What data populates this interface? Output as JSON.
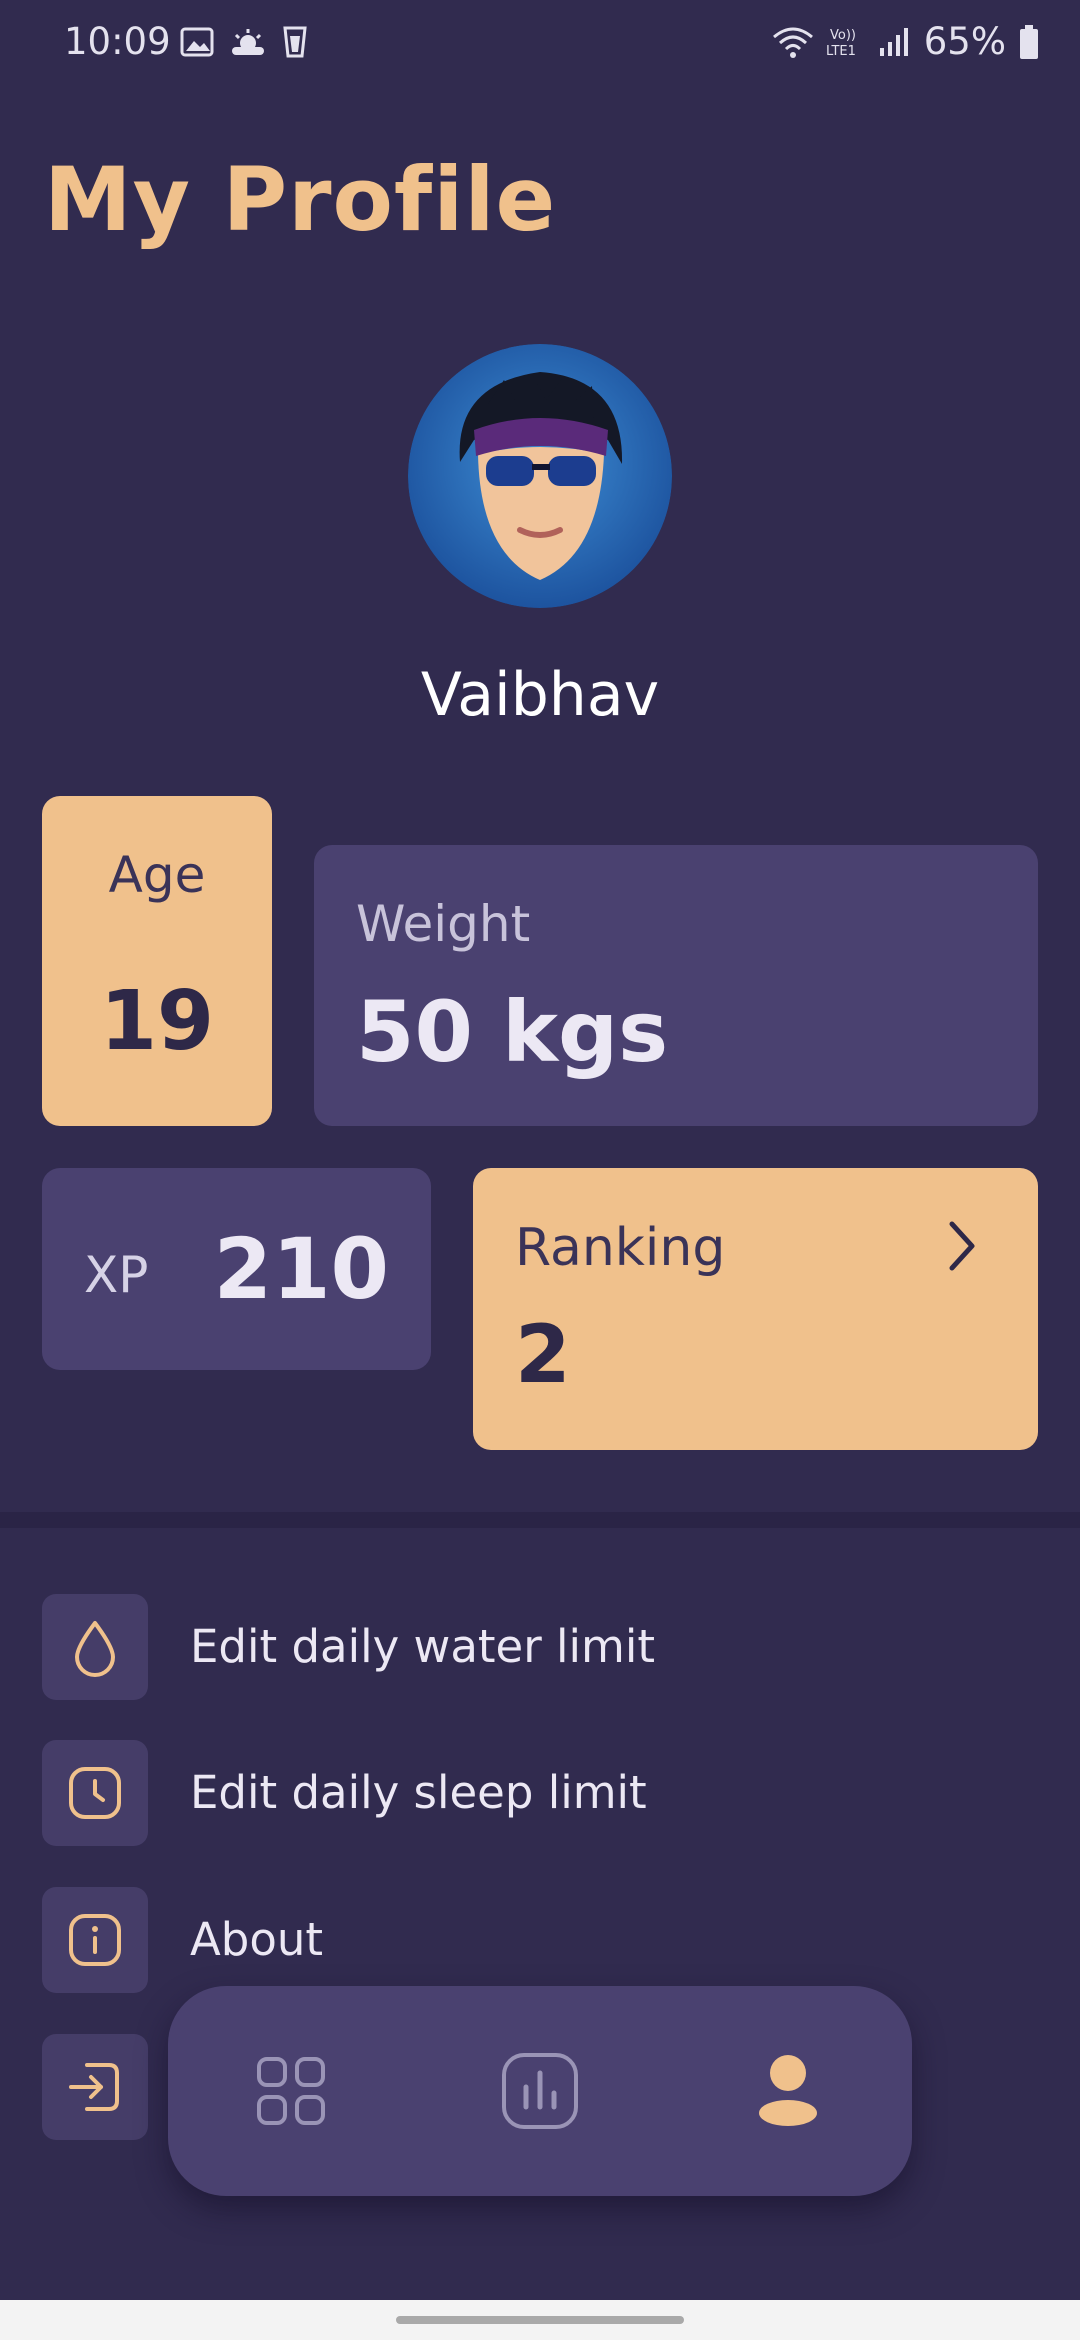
{
  "status_bar": {
    "time": "10:09",
    "battery": "65%",
    "icons_left": [
      "image-icon",
      "weather-icon",
      "glass-icon"
    ],
    "icons_right": [
      "wifi-icon",
      "volte-icon",
      "signal-icon",
      "battery-icon"
    ]
  },
  "header": {
    "title": "My Profile"
  },
  "profile": {
    "name": "Vaibhav"
  },
  "stats": {
    "age": {
      "label": "Age",
      "value": "19"
    },
    "weight": {
      "label": "Weight",
      "value": "50 kgs"
    },
    "xp": {
      "label": "XP",
      "value": "210"
    },
    "ranking": {
      "label": "Ranking",
      "value": "2"
    }
  },
  "menu": {
    "items": [
      {
        "label": "Edit daily water limit",
        "icon": "water-drop-icon"
      },
      {
        "label": "Edit daily sleep limit",
        "icon": "clock-icon"
      },
      {
        "label": "About",
        "icon": "info-icon"
      },
      {
        "label": "",
        "icon": "logout-icon"
      }
    ]
  },
  "bottom_nav": {
    "items": [
      {
        "icon": "grid-icon",
        "active": false
      },
      {
        "icon": "bar-chart-icon",
        "active": false
      },
      {
        "icon": "profile-icon",
        "active": true
      }
    ]
  },
  "colors": {
    "background": "#312b4f",
    "accent": "#f0c18c",
    "card": "#4a4170"
  }
}
